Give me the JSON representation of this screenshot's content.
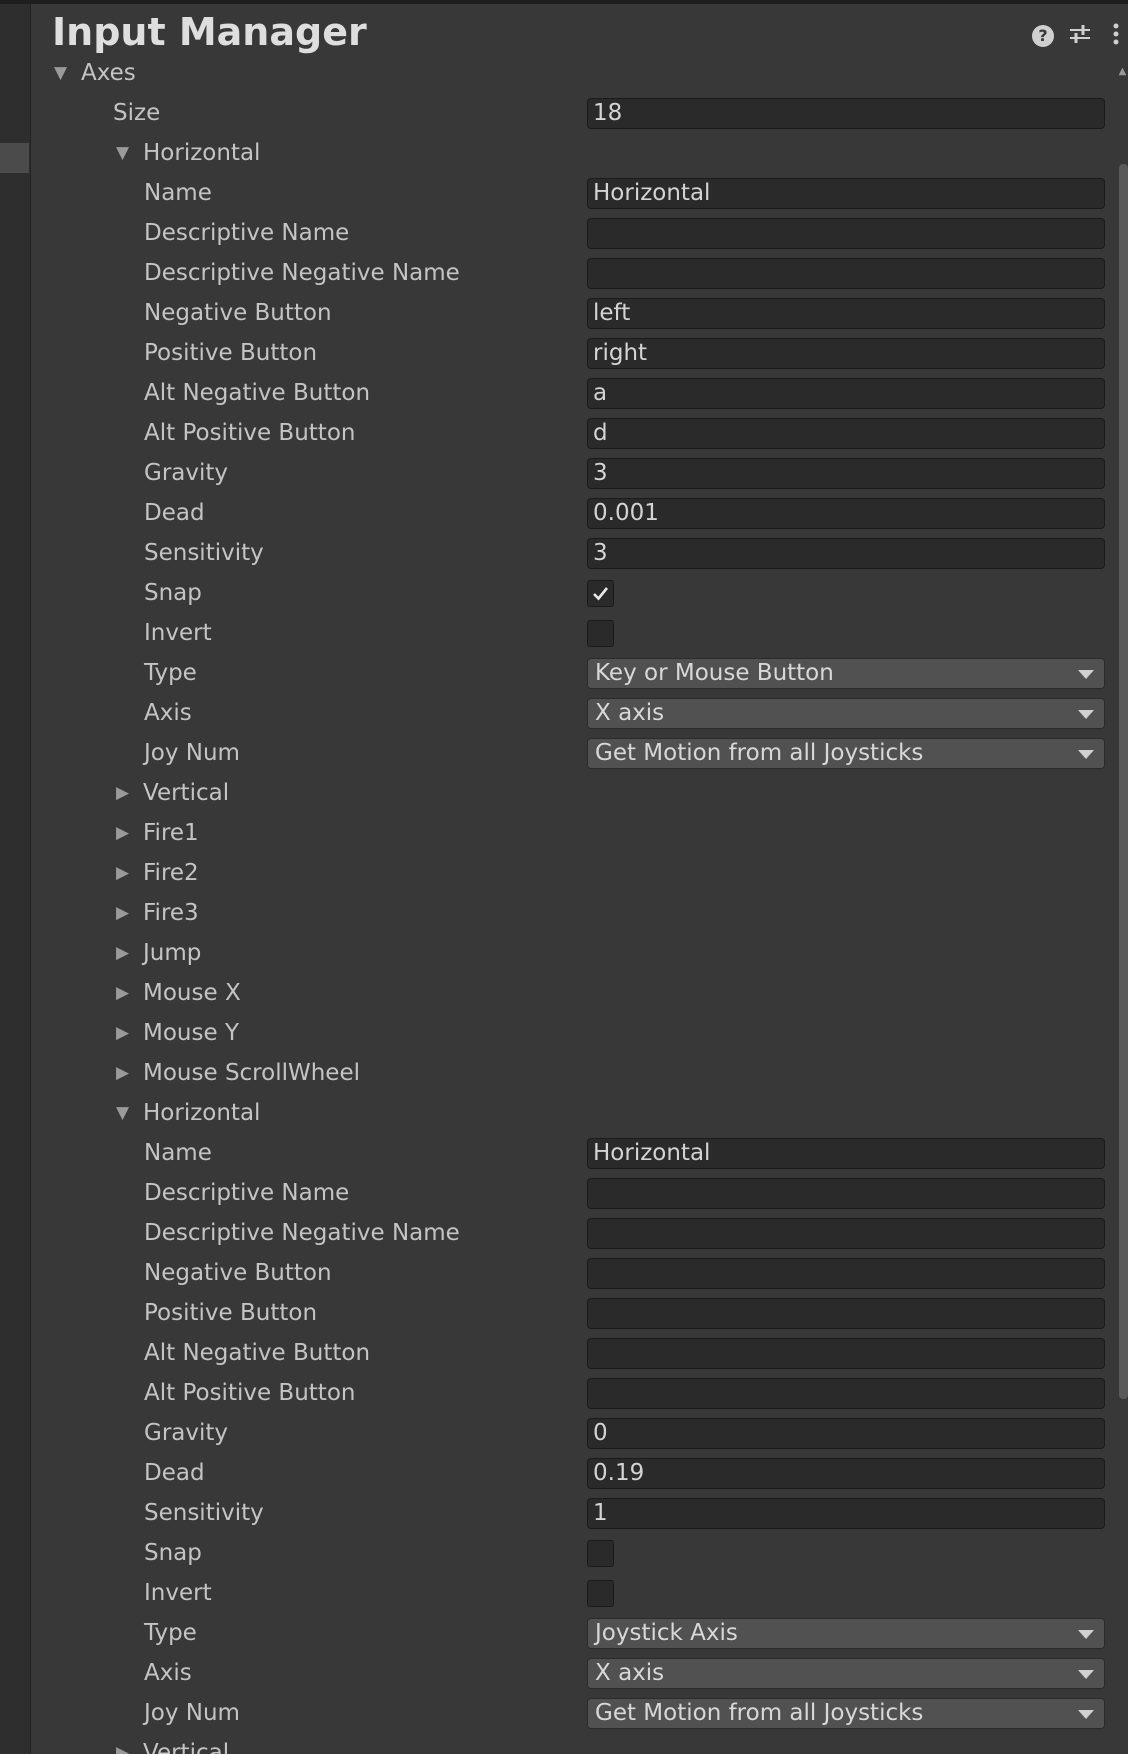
{
  "window": {
    "title": "Input Manager"
  },
  "axes": {
    "label": "Axes",
    "size_label": "Size",
    "size_value": "18",
    "entries": [
      {
        "name": "Horizontal",
        "expanded": true,
        "fields": {
          "name": {
            "label": "Name",
            "value": "Horizontal"
          },
          "descriptive_name": {
            "label": "Descriptive Name",
            "value": ""
          },
          "descriptive_negative_name": {
            "label": "Descriptive Negative Name",
            "value": ""
          },
          "negative_button": {
            "label": "Negative Button",
            "value": "left"
          },
          "positive_button": {
            "label": "Positive Button",
            "value": "right"
          },
          "alt_negative_button": {
            "label": "Alt Negative Button",
            "value": "a"
          },
          "alt_positive_button": {
            "label": "Alt Positive Button",
            "value": "d"
          },
          "gravity": {
            "label": "Gravity",
            "value": "3"
          },
          "dead": {
            "label": "Dead",
            "value": "0.001"
          },
          "sensitivity": {
            "label": "Sensitivity",
            "value": "3"
          },
          "snap": {
            "label": "Snap",
            "checked": true
          },
          "invert": {
            "label": "Invert",
            "checked": false
          },
          "type": {
            "label": "Type",
            "value": "Key or Mouse Button"
          },
          "axis": {
            "label": "Axis",
            "value": "X axis"
          },
          "joy_num": {
            "label": "Joy Num",
            "value": "Get Motion from all Joysticks"
          }
        }
      },
      {
        "name": "Vertical",
        "expanded": false
      },
      {
        "name": "Fire1",
        "expanded": false
      },
      {
        "name": "Fire2",
        "expanded": false
      },
      {
        "name": "Fire3",
        "expanded": false
      },
      {
        "name": "Jump",
        "expanded": false
      },
      {
        "name": "Mouse X",
        "expanded": false
      },
      {
        "name": "Mouse Y",
        "expanded": false
      },
      {
        "name": "Mouse ScrollWheel",
        "expanded": false
      },
      {
        "name": "Horizontal",
        "expanded": true,
        "fields": {
          "name": {
            "label": "Name",
            "value": "Horizontal"
          },
          "descriptive_name": {
            "label": "Descriptive Name",
            "value": ""
          },
          "descriptive_negative_name": {
            "label": "Descriptive Negative Name",
            "value": ""
          },
          "negative_button": {
            "label": "Negative Button",
            "value": ""
          },
          "positive_button": {
            "label": "Positive Button",
            "value": ""
          },
          "alt_negative_button": {
            "label": "Alt Negative Button",
            "value": ""
          },
          "alt_positive_button": {
            "label": "Alt Positive Button",
            "value": ""
          },
          "gravity": {
            "label": "Gravity",
            "value": "0"
          },
          "dead": {
            "label": "Dead",
            "value": "0.19"
          },
          "sensitivity": {
            "label": "Sensitivity",
            "value": "1"
          },
          "snap": {
            "label": "Snap",
            "checked": false
          },
          "invert": {
            "label": "Invert",
            "checked": false
          },
          "type": {
            "label": "Type",
            "value": "Joystick Axis"
          },
          "axis": {
            "label": "Axis",
            "value": "X axis"
          },
          "joy_num": {
            "label": "Joy Num",
            "value": "Get Motion from all Joysticks"
          }
        }
      },
      {
        "name": "Vertical",
        "expanded": false
      }
    ]
  },
  "icons": {
    "help": "help-icon",
    "settings": "sliders-icon",
    "more": "more-vertical-icon",
    "foldout_expanded": "triangle-down-icon",
    "foldout_collapsed": "triangle-right-icon",
    "dropdown": "dropdown-arrow-icon",
    "check": "checkmark-icon"
  },
  "colors": {
    "background": "#383838",
    "field_background": "#2a2a2a",
    "dropdown_background": "#515151",
    "text": "#c4c4c4"
  }
}
